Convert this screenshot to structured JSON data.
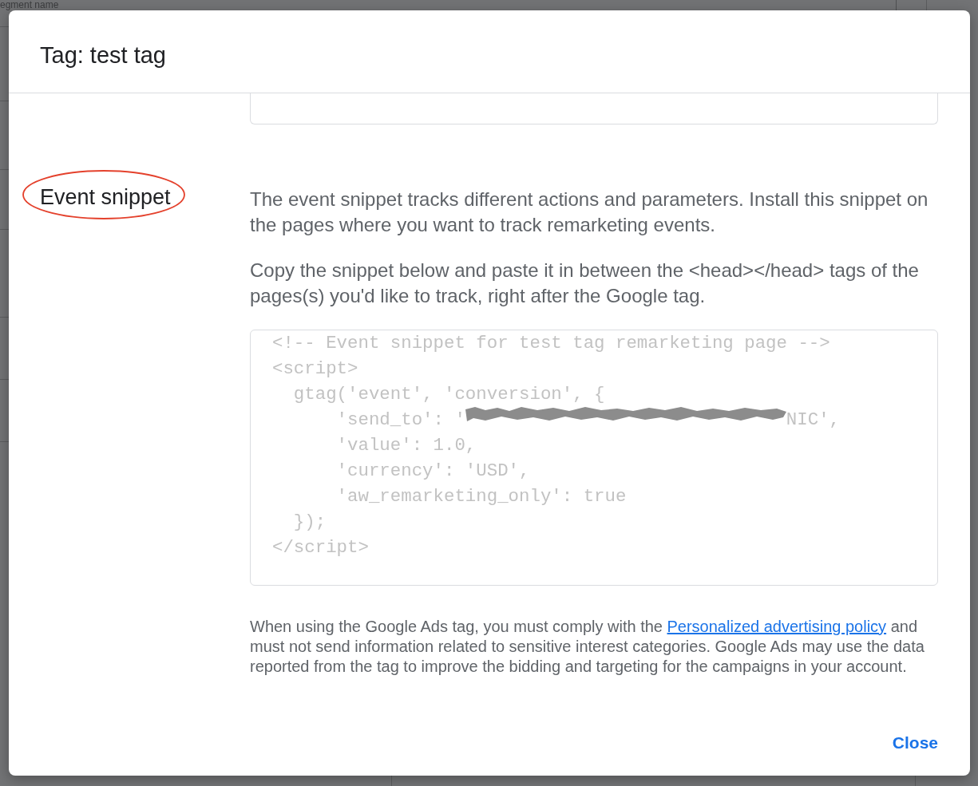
{
  "background": {
    "text": "egment name"
  },
  "dialog": {
    "title": "Tag: test tag",
    "section": {
      "label": "Event snippet",
      "circled": true
    },
    "paragraphs": [
      "The event snippet tracks different actions and parameters. Install this snippet on the pages where you want to track remarketing events.",
      "Copy the snippet below and paste it in between the <head></head> tags of the pages(s) you'd like to track, right after the Google tag."
    ],
    "code_lines": [
      {
        "text": "<!-- Event snippet for test tag remarketing page -->",
        "redacted": false
      },
      {
        "text": "<script>",
        "redacted": false
      },
      {
        "text": "  gtag('event', 'conversion', {",
        "redacted": false
      },
      {
        "text": "      'send_to': '",
        "redacted": true,
        "tail": "NIC',"
      },
      {
        "text": "      'value': 1.0,",
        "redacted": false
      },
      {
        "text": "      'currency': 'USD',",
        "redacted": false
      },
      {
        "text": "      'aw_remarketing_only': true",
        "redacted": false
      },
      {
        "text": "  });",
        "redacted": false
      },
      {
        "text": "</script>",
        "redacted": false
      }
    ],
    "notice": {
      "before": "When using the Google Ads tag, you must comply with the ",
      "link": "Personalized advertising policy",
      "after": " and must not send information related to sensitive interest categories. Google Ads may use the data reported from the tag to improve the bidding and targeting for the campaigns in your account."
    },
    "close_button": "Close"
  }
}
